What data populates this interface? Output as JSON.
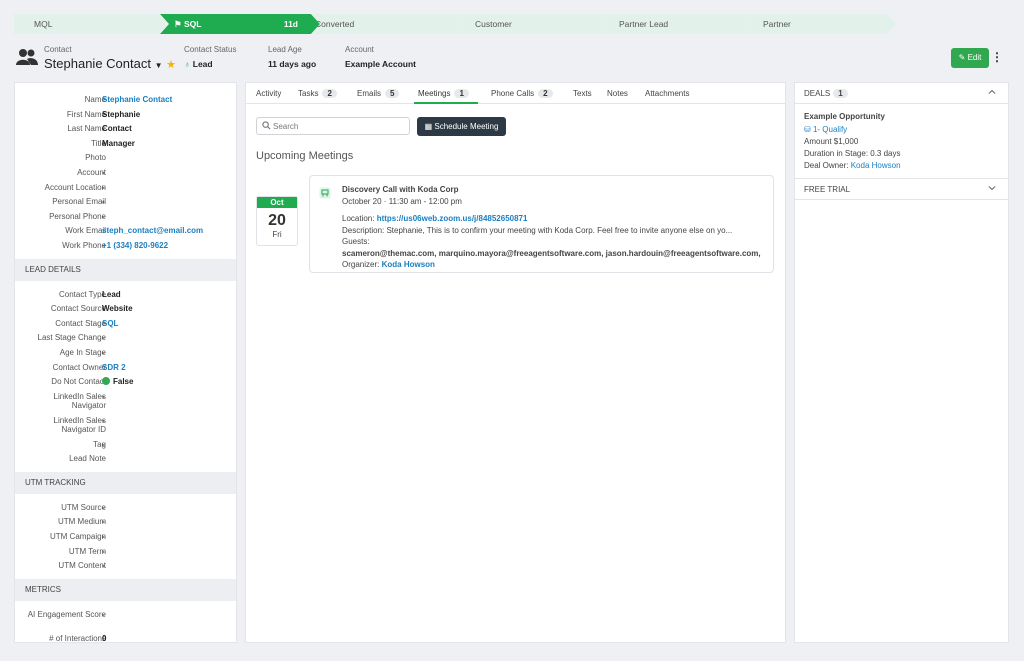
{
  "pipeline": [
    {
      "label": "MQL",
      "age": ""
    },
    {
      "label": "SQL",
      "age": "11d"
    },
    {
      "label": "Converted",
      "age": ""
    },
    {
      "label": "Customer",
      "age": ""
    },
    {
      "label": "Partner Lead",
      "age": ""
    },
    {
      "label": "Partner",
      "age": ""
    }
  ],
  "header": {
    "contact_caption": "Contact",
    "contact_name": "Stephanie Contact",
    "status_caption": "Contact Status",
    "status_value": "Lead",
    "age_caption": "Lead Age",
    "age_value": "11 days ago",
    "account_caption": "Account",
    "account_value": "Example Account",
    "edit_label": "Edit"
  },
  "details": [
    {
      "key": "Name",
      "value": "Stephanie Contact",
      "style": "link"
    },
    {
      "key": "First Name",
      "value": "Stephanie",
      "style": "bold"
    },
    {
      "key": "Last Name",
      "value": "Contact",
      "style": "bold"
    },
    {
      "key": "Title",
      "value": "Manager",
      "style": "bold"
    },
    {
      "key": "Photo",
      "value": "",
      "style": "bold"
    },
    {
      "key": "Account",
      "value": "-",
      "style": "bold"
    },
    {
      "key": "Account Location",
      "value": "-",
      "style": "bold"
    },
    {
      "key": "Personal Email",
      "value": "-",
      "style": "bold"
    },
    {
      "key": "Personal Phone",
      "value": "-",
      "style": "bold"
    },
    {
      "key": "Work Email",
      "value": "steph_contact@email.com",
      "style": "link"
    },
    {
      "key": "Work Phone",
      "value": "+1 (334) 820-9622",
      "style": "link"
    }
  ],
  "lead_details": {
    "title": "LEAD DETAILS",
    "rows": [
      {
        "key": "Contact Type",
        "value": "Lead",
        "style": "bold"
      },
      {
        "key": "Contact Source",
        "value": "Website",
        "style": "bold"
      },
      {
        "key": "Contact Stage",
        "value": "SQL",
        "style": "link"
      },
      {
        "key": "Last Stage Change",
        "value": "-",
        "style": "bold"
      },
      {
        "key": "Age In Stage",
        "value": "-",
        "style": "bold"
      },
      {
        "key": "Contact Owner",
        "value": "SDR 2",
        "style": "link"
      },
      {
        "key": "Do Not Contact",
        "value": "False",
        "style": "dot"
      },
      {
        "key": "LinkedIn Sales Navigator",
        "value": "-",
        "style": "bold"
      },
      {
        "key": "LinkedIn Sales Navigator ID",
        "value": "-",
        "style": "bold"
      },
      {
        "key": "Tag",
        "value": "-",
        "style": "bold"
      },
      {
        "key": "Lead Note",
        "value": "",
        "style": "bold"
      }
    ]
  },
  "utm": {
    "title": "UTM TRACKING",
    "rows": [
      {
        "key": "UTM Source",
        "value": "-"
      },
      {
        "key": "UTM Medium",
        "value": "-"
      },
      {
        "key": "UTM Campaign",
        "value": "-"
      },
      {
        "key": "UTM Term",
        "value": "-"
      },
      {
        "key": "UTM Content",
        "value": "-"
      }
    ]
  },
  "metrics": {
    "title": "METRICS",
    "rows": [
      {
        "key": "AI Engagement Score",
        "value": "-"
      },
      {
        "key": "# of Interactions",
        "value": "0"
      }
    ]
  },
  "tabs": [
    {
      "label": "Activity",
      "count": ""
    },
    {
      "label": "Tasks",
      "count": "2"
    },
    {
      "label": "Emails",
      "count": "5"
    },
    {
      "label": "Meetings",
      "count": "1"
    },
    {
      "label": "Phone Calls",
      "count": "2"
    },
    {
      "label": "Texts",
      "count": ""
    },
    {
      "label": "Notes",
      "count": ""
    },
    {
      "label": "Attachments",
      "count": ""
    }
  ],
  "meetings": {
    "search_placeholder": "Search",
    "schedule_label": "Schedule Meeting",
    "upcoming_title": "Upcoming Meetings",
    "date": {
      "month": "Oct",
      "day": "20",
      "dow": "Fri"
    },
    "title": "Discovery Call with Koda Corp",
    "when": "October 20  ·  11:30 am - 12:00 pm",
    "location_label": "Location:",
    "location_value": "https://us06web.zoom.us/j/84852650871",
    "description": "Description: Stephanie, This is to confirm your meeting with Koda Corp. Feel free to invite anyone else on yo...",
    "guests_label": "Guests:",
    "guests_value": "scameron@themac.com, marquino.mayora@freeagentsoftware.com, jason.hardouin@freeagentsoftware.com,",
    "organizer_label": "Organizer:",
    "organizer_value": "Koda Howson"
  },
  "deals": {
    "title": "DEALS",
    "count": "1",
    "name": "Example Opportunity",
    "stage": "1- Qualify",
    "amount": "Amount  $1,000",
    "duration": "Duration in Stage:  0.3 days",
    "owner_label": "Deal Owner:",
    "owner_value": "Koda Howson"
  },
  "free_trial": {
    "title": "FREE TRIAL"
  },
  "colors": {
    "accent": "#1fab4f",
    "link": "#1a7fc1",
    "dark_button": "#2d3a46"
  }
}
